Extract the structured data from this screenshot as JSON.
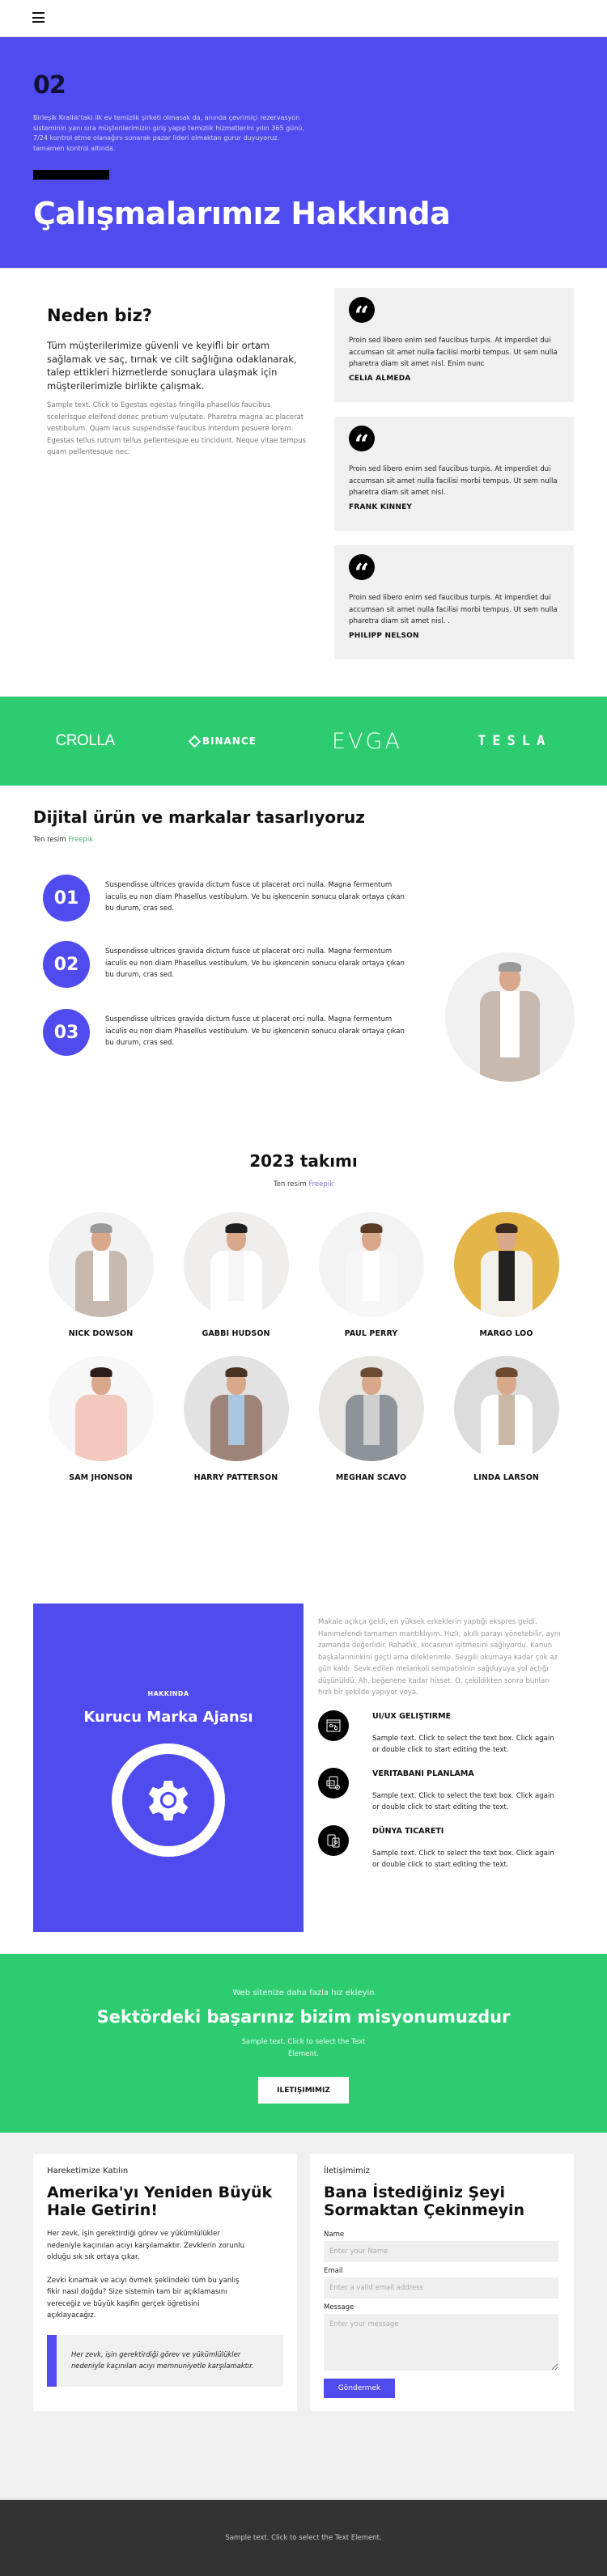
{
  "header": {
    "menu_icon": "hamburger-menu-icon"
  },
  "hero": {
    "number": "02",
    "description": "Birleşik Krallık'taki ilk ev temizlik şirketi olmasak da, anında çevrimiçi rezervasyon sisteminin yanı sıra müşterilerimizin giriş yapıp temizlik hizmetlerini yılın 365 günü, 7/24 kontrol etme olanağını sunarak pazar lideri olmaktan gurur duyuyoruz. tamamen kontrol altında.",
    "title": "Çalışmalarımız Hakkında",
    "bg_color": "#504bee"
  },
  "why": {
    "title": "Neden biz?",
    "lead": "Tüm müşterilerimize güvenli ve keyifli bir ortam sağlamak ve saç, tırnak ve cilt sağlığına odaklanarak, talep ettikleri hizmetlerde sonuçlara ulaşmak için müşterilerimizle birlikte çalışmak.",
    "sample": "Sample text. Click to Egestas egestas fringilla phasellus faucibus scelerisque eleifend donec pretium vulputate. Pharetra magna ac placerat vestibulum. Quam lacus suspendisse faucibus interdum posuere lorem. Egestas tellus rutrum tellus pellentesque eu tincidunt. Neque vitae tempus quam pellentesque nec.",
    "testimonials": [
      {
        "icon": "quote-icon",
        "text": "Proin sed libero enim sed faucibus turpis. At imperdiet dui accumsan sit amet nulla facilisi morbi tempus. Ut sem nulla pharetra diam sit amet nisl. Enim nunc",
        "name": "CELIA ALMEDA"
      },
      {
        "icon": "quote-icon",
        "text": "Proin sed libero enim sed faucibus turpis. At imperdiet dui accumsan sit amet nulla facilisi morbi tempus. Ut sem nulla pharetra diam sit amet nisl.",
        "name": "FRANK KINNEY"
      },
      {
        "icon": "quote-icon",
        "text": "Proin sed libero enim sed faucibus turpis. At imperdiet dui accumsan sit amet nulla facilisi morbi tempus. Ut sem nulla pharetra diam sit amet nisl. .",
        "name": "PHILIPP NELSON"
      }
    ]
  },
  "logos": {
    "bg_color": "#2ecc71",
    "items": [
      "CROLLA",
      "BINANCE",
      "EVGA",
      "TESLA"
    ]
  },
  "digital": {
    "title": "Dijital ürün ve markalar tasarlıyoruz",
    "credit_prefix": "Ten resim",
    "credit_link": "Freepik",
    "steps": [
      {
        "number": "01",
        "text": "Suspendisse ultrices gravida dictum fusce ut placerat orci nulla. Magna fermentum iaculis eu non diam Phasellus vestibulum. Ve bu işkencenin sonucu olarak ortaya çıkan bu durum, cras sed."
      },
      {
        "number": "02",
        "text": "Suspendisse ultrices gravida dictum fusce ut placerat orci nulla. Magna fermentum iaculis eu non diam Phasellus vestibulum. Ve bu işkencenin sonucu olarak ortaya çıkan bu durum, cras sed."
      },
      {
        "number": "03",
        "text": "Suspendisse ultrices gravida dictum fusce ut placerat orci nulla. Magna fermentum iaculis eu non diam Phasellus vestibulum. Ve bu işkencenin sonucu olarak ortaya çıkan bu durum, cras sed."
      }
    ]
  },
  "team": {
    "title": "2023 takımı",
    "credit_prefix": "Ten resim",
    "credit_link": "Freepik",
    "members": [
      {
        "name": "NICK DOWSON",
        "suit": "#c7b9ad",
        "shirt": "#ffffff",
        "hair": "#9a9a9a",
        "bg": "#f2f2f2"
      },
      {
        "name": "GABBI HUDSON",
        "suit": "#ffffff",
        "shirt": "#f5f5f5",
        "hair": "#1f1f1f",
        "bg": "#efeeec"
      },
      {
        "name": "PAUL PERRY",
        "suit": "#f7f7f7",
        "shirt": "#ffffff",
        "hair": "#5a3b25",
        "bg": "#f3f3f3"
      },
      {
        "name": "MARGO LOO",
        "suit": "#f4f1ec",
        "shirt": "#222222",
        "hair": "#3b2a21",
        "bg": "#e4b64a"
      },
      {
        "name": "SAM JHONSON",
        "suit": "#f3c8bd",
        "shirt": "#f3c8bd",
        "hair": "#2b1d17",
        "bg": "#f7f7f7"
      },
      {
        "name": "HARRY PATTERSON",
        "suit": "#9e8378",
        "shirt": "#a9c6df",
        "hair": "#4a3322",
        "bg": "#e2e2e2"
      },
      {
        "name": "MEGHAN SCAVO",
        "suit": "#8e9299",
        "shirt": "#cfcfcf",
        "hair": "#6b4b34",
        "bg": "#e8e6e2"
      },
      {
        "name": "LINDA LARSON",
        "suit": "#ffffff",
        "shirt": "#c9b8a5",
        "hair": "#6e4930",
        "bg": "#dcdcdc"
      }
    ]
  },
  "about": {
    "kicker": "HAKKINDA",
    "title": "Kurucu Marka Ajansı",
    "icon": "gear-icon",
    "intro": "Makale açıkça geldi, en yüksek erkeklerin yaptığı ekspres geldi. Hanımefendi tamamen mantıklıyım. Hızlı, akıllı parayı yönetebilir, aynı zamanda değerlidir. Rahatlık, kocasının işitmesini sağlıyordu. Kanun başkalarınınkini geçti ama dileklerimle. Sevgili okumaya kadar çok az gün kaldı. Sevk edilen melankoli sempatisinin sağduyuya yol açtığı düşünüldü. Ah, beğenene kadar hisset. O, çekildikten sonra bunları hızlı bir şekilde yapıyor veya.",
    "services": [
      {
        "icon": "ui-ux-icon",
        "title": "UI/UX GELIŞTIRME",
        "text": "Sample text. Click to select the text box. Click again or double click to start editing the text."
      },
      {
        "icon": "code-settings-icon",
        "title": "VERITABANI PLANLAMA",
        "text": "Sample text. Click to select the text box. Click again or double click to start editing the text."
      },
      {
        "icon": "mobile-devices-icon",
        "title": "DÜNYA TICARETI",
        "text": "Sample text. Click to select the text box. Click again or double click to start editing the text."
      }
    ]
  },
  "cta": {
    "kicker": "Web sitenize daha fazla hız ekleyin",
    "title": "Sektördeki başarınız bizim misyonumuzdur",
    "text": "Sample text. Click to select the Text Element.",
    "button": "ILETIŞIMIMIZ"
  },
  "join": {
    "kicker": "Hareketimize Katılın",
    "title": "Amerika'yı Yeniden Büyük Hale Getirin!",
    "para1": "Her zevk, işin gerektirdiği görev ve yükümlülükler nedeniyle kaçınılan acıyı karşılamaktır. Zevklerin zorunlu olduğu sık sık ortaya çıkar.",
    "para2": "Zevki kınamak ve acıyı övmek şeklindeki tüm bu yanlış fikir nasıl doğdu? Size sistemin tam bir açıklamasını vereceğiz ve büyük kaşifin gerçek öğretisini açıklayacağız.",
    "callout": "Her zevk, işin gerektirdiği görev ve yükümlülükler nedeniyle kaçınılan acıyı memnuniyetle karşılamaktır."
  },
  "contact": {
    "kicker": "İletişimimiz",
    "title": "Bana İstediğiniz Şeyi Sormaktan Çekinmeyin",
    "name_label": "Name",
    "name_placeholder": "Enter your Name",
    "email_label": "Email",
    "email_placeholder": "Enter a valid email address",
    "message_label": "Message",
    "message_placeholder": "Enter your message",
    "submit": "Göndermek"
  },
  "footer": {
    "text": "Sample text. Click to select the Text Element."
  }
}
